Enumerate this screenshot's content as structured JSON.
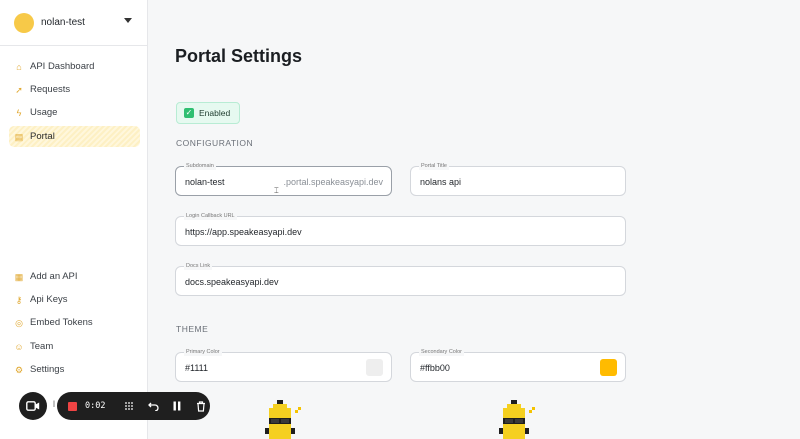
{
  "sidebar": {
    "workspace_name": "nolan-test",
    "top_items": [
      {
        "label": "API Dashboard",
        "icon": "home-icon"
      },
      {
        "label": "Requests",
        "icon": "rocket-icon"
      },
      {
        "label": "Usage",
        "icon": "lightning-icon"
      },
      {
        "label": "Portal",
        "icon": "portal-icon",
        "active": true
      }
    ],
    "bottom_items": [
      {
        "label": "Add an API",
        "icon": "add-api-icon"
      },
      {
        "label": "Api Keys",
        "icon": "key-icon"
      },
      {
        "label": "Embed Tokens",
        "icon": "embed-icon"
      },
      {
        "label": "Team",
        "icon": "team-icon"
      },
      {
        "label": "Settings",
        "icon": "gear-icon"
      }
    ],
    "partial_bottom_text": "l"
  },
  "main": {
    "title": "Portal Settings",
    "status_badge": "Enabled",
    "configuration": {
      "section_title": "CONFIGURATION",
      "subdomain": {
        "label": "Subdomain",
        "value": "nolan-test",
        "suffix": ".portal.speakeasyapi.dev"
      },
      "portal_title": {
        "label": "Portal Title",
        "value": "nolans api"
      },
      "login_callback": {
        "label": "Login Callback URL",
        "value": "https://app.speakeasyapi.dev"
      },
      "docs_link": {
        "label": "Docs Link",
        "value": "docs.speakeasyapi.dev"
      }
    },
    "theme": {
      "section_title": "THEME",
      "primary_color": {
        "label": "Primary Color",
        "value": "#1111",
        "swatch": "#eeeeee"
      },
      "secondary_color": {
        "label": "Secondary Color",
        "value": "#ffbb00",
        "swatch": "#ffbb00"
      }
    }
  },
  "recorder": {
    "time": "0:02",
    "stop_color": "#ef4444"
  },
  "colors": {
    "accent_yellow": "#f7c948",
    "enabled_green": "#2fbf71"
  }
}
